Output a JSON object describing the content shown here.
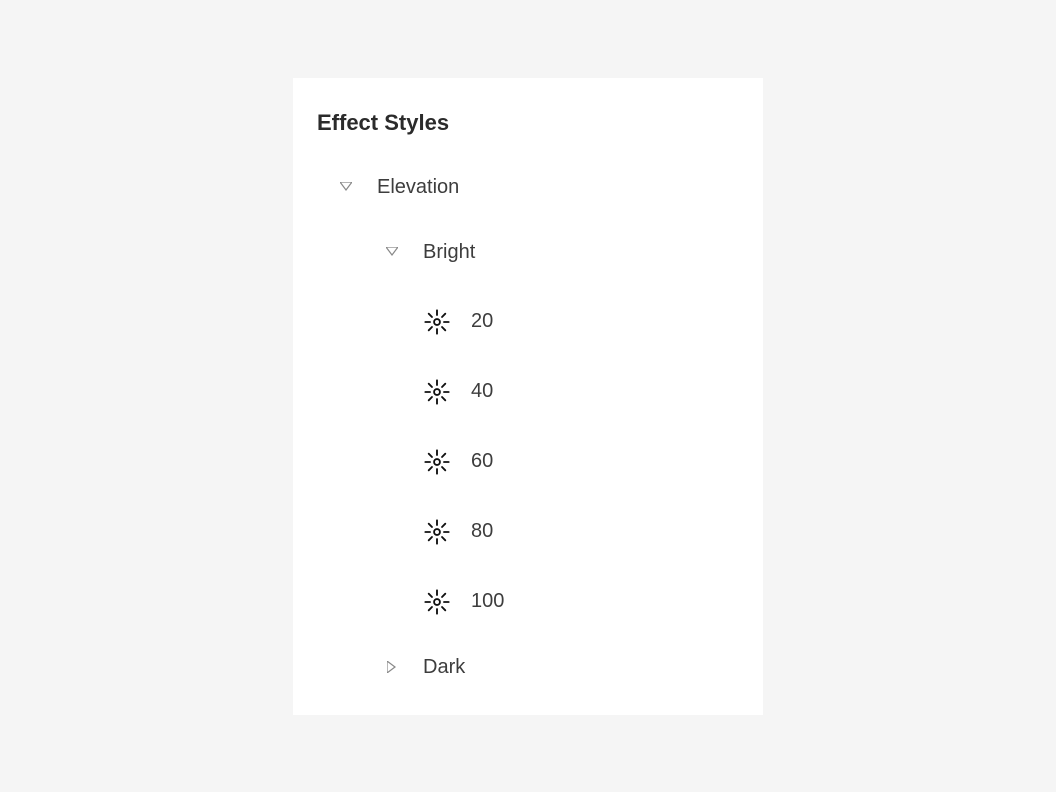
{
  "panel": {
    "title": "Effect Styles"
  },
  "tree": {
    "elevation": {
      "label": "Elevation",
      "expanded": true,
      "children": {
        "bright": {
          "label": "Bright",
          "expanded": true,
          "items": [
            {
              "label": "20"
            },
            {
              "label": "40"
            },
            {
              "label": "60"
            },
            {
              "label": "80"
            },
            {
              "label": "100"
            }
          ]
        },
        "dark": {
          "label": "Dark",
          "expanded": false
        }
      }
    }
  }
}
